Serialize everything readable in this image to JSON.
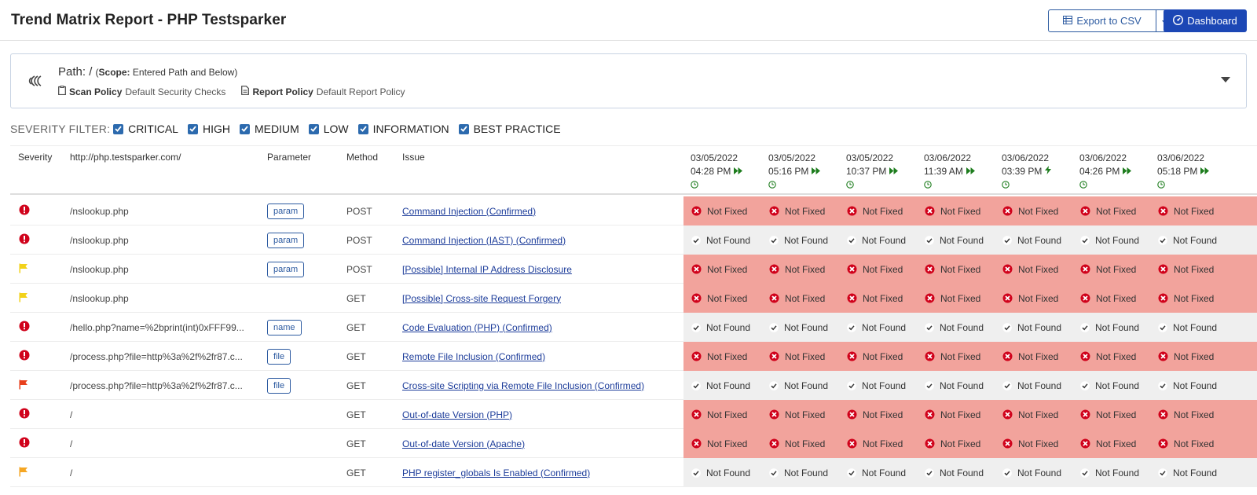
{
  "header": {
    "title": "Trend Matrix Report - PHP Testsparker",
    "export_label": "Export to CSV",
    "dashboard_label": "Dashboard"
  },
  "path_box": {
    "path_prefix": "Path: /",
    "scope_label": "Scope:",
    "scope_value": "Entered Path and Below",
    "scan_policy_label": "Scan Policy",
    "scan_policy_value": "Default Security Checks",
    "report_policy_label": "Report Policy",
    "report_policy_value": "Default Report Policy"
  },
  "filter": {
    "label": "SEVERITY FILTER:",
    "items": [
      "CRITICAL",
      "HIGH",
      "MEDIUM",
      "LOW",
      "INFORMATION",
      "BEST PRACTICE"
    ]
  },
  "table": {
    "headers": {
      "severity": "Severity",
      "url": "http://php.testsparker.com/",
      "parameter": "Parameter",
      "method": "Method",
      "issue": "Issue"
    },
    "scans": [
      {
        "date": "03/05/2022",
        "time": "04:28 PM",
        "icon": "fast-forward-icon"
      },
      {
        "date": "03/05/2022",
        "time": "05:16 PM",
        "icon": "fast-forward-icon"
      },
      {
        "date": "03/05/2022",
        "time": "10:37 PM",
        "icon": "fast-forward-icon"
      },
      {
        "date": "03/06/2022",
        "time": "11:39 AM",
        "icon": "fast-forward-icon"
      },
      {
        "date": "03/06/2022",
        "time": "03:39 PM",
        "icon": "lightning-icon"
      },
      {
        "date": "03/06/2022",
        "time": "04:26 PM",
        "icon": "fast-forward-icon"
      },
      {
        "date": "03/06/2022",
        "time": "05:18 PM",
        "icon": "fast-forward-icon"
      }
    ],
    "status_labels": {
      "fixed": "Not Fixed",
      "found": "Not Found"
    },
    "rows": [
      {
        "severity": "critical",
        "url": "/nslookup.php",
        "parameter": "param",
        "method": "POST",
        "issue": "Command Injection (Confirmed)",
        "status": "fixed"
      },
      {
        "severity": "critical",
        "url": "/nslookup.php",
        "parameter": "param",
        "method": "POST",
        "issue": "Command Injection (IAST) (Confirmed)",
        "status": "found"
      },
      {
        "severity": "low",
        "url": "/nslookup.php",
        "parameter": "param",
        "method": "POST",
        "issue": "[Possible] Internal IP Address Disclosure",
        "status": "fixed"
      },
      {
        "severity": "low",
        "url": "/nslookup.php",
        "parameter": "",
        "method": "GET",
        "issue": "[Possible] Cross-site Request Forgery",
        "status": "fixed"
      },
      {
        "severity": "critical",
        "url": "/hello.php?name=%2bprint(int)0xFFF99...",
        "parameter": "name",
        "method": "GET",
        "issue": "Code Evaluation (PHP) (Confirmed)",
        "status": "found"
      },
      {
        "severity": "critical",
        "url": "/process.php?file=http%3a%2f%2fr87.c...",
        "parameter": "file",
        "method": "GET",
        "issue": "Remote File Inclusion (Confirmed)",
        "status": "fixed"
      },
      {
        "severity": "high",
        "url": "/process.php?file=http%3a%2f%2fr87.c...",
        "parameter": "file",
        "method": "GET",
        "issue": "Cross-site Scripting via Remote File Inclusion (Confirmed)",
        "status": "found"
      },
      {
        "severity": "critical",
        "url": "/",
        "parameter": "",
        "method": "GET",
        "issue": "Out-of-date Version (PHP)",
        "status": "fixed"
      },
      {
        "severity": "critical",
        "url": "/",
        "parameter": "",
        "method": "GET",
        "issue": "Out-of-date Version (Apache)",
        "status": "fixed"
      },
      {
        "severity": "medium",
        "url": "/",
        "parameter": "",
        "method": "GET",
        "issue": "PHP register_globals Is Enabled (Confirmed)",
        "status": "found"
      }
    ]
  },
  "colors": {
    "accent": "#1c47b5",
    "critical": "#d0021b",
    "high": "#e8401c",
    "medium": "#f5a623",
    "low": "#f2d21a",
    "not_fixed_bg": "#f2a39c",
    "not_found_bg": "#efefef",
    "scan_icon": "#1e7d1e"
  }
}
